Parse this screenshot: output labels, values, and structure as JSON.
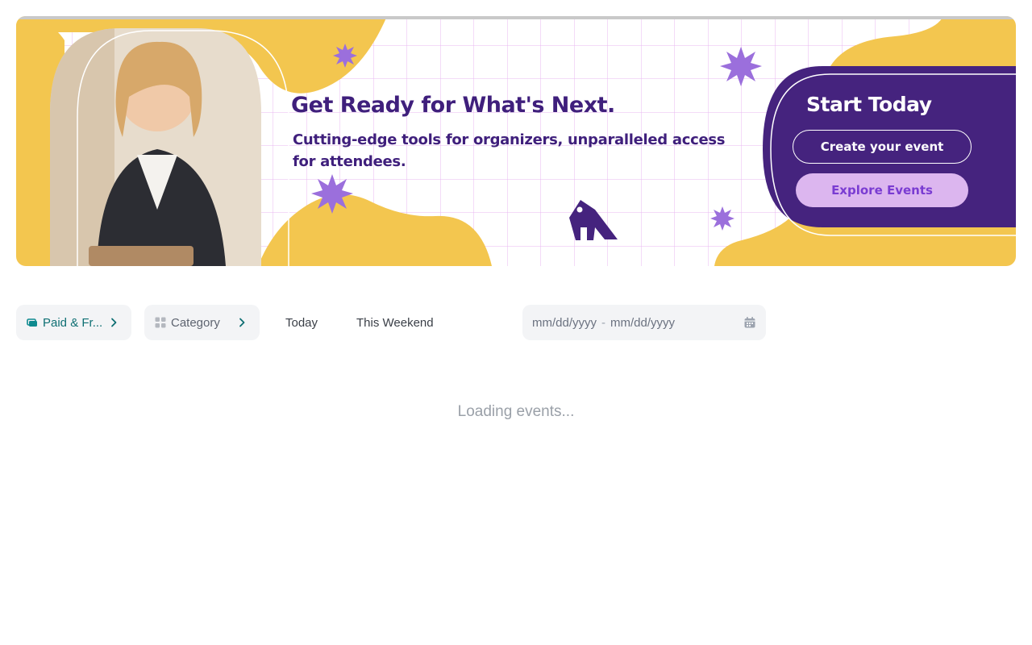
{
  "banner": {
    "headline": "Get Ready for What's Next.",
    "subline": "Cutting-edge tools for organizers, unparalleled access for attendees.",
    "cta_title": "Start Today",
    "create_label": "Create your event",
    "explore_label": "Explore Events",
    "colors": {
      "yellow": "#f3c64f",
      "purple": "#45237e",
      "lavender": "#dcb6ef",
      "star": "#9b6fdc",
      "grid": "#e9b7f2"
    }
  },
  "filters": {
    "price_label": "Paid & Fr...",
    "category_label": "Category",
    "today_label": "Today",
    "weekend_label": "This Weekend",
    "date_start_placeholder": "mm/dd/yyyy",
    "date_separator": "-",
    "date_end_placeholder": "mm/dd/yyyy",
    "price_color": "#0e6f73",
    "icons": {
      "price": "ticket-icon",
      "category": "grid-icon",
      "chevron": "chevron-right-icon",
      "calendar": "calendar-icon"
    }
  },
  "status": {
    "loading": "Loading events..."
  }
}
